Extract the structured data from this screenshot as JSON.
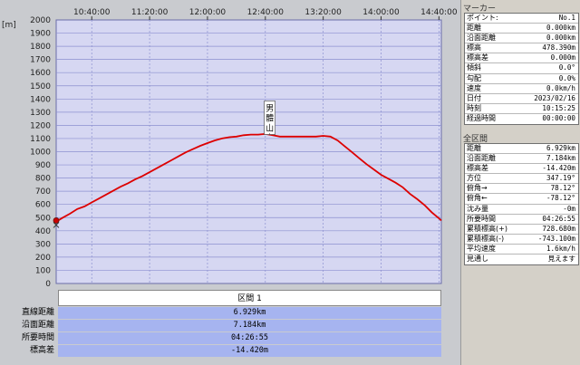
{
  "chart_data": {
    "type": "line",
    "title": "",
    "xlabel": "",
    "ylabel": "[m]",
    "ylim": [
      0,
      2000
    ],
    "yticks": [
      "0",
      "100",
      "200",
      "300",
      "400",
      "500",
      "600",
      "700",
      "800",
      "900",
      "1000",
      "1100",
      "1200",
      "1300",
      "1400",
      "1500",
      "1600",
      "1700",
      "1800",
      "1900",
      "2000"
    ],
    "xlim": [
      "10:15:25",
      "14:41:40"
    ],
    "xticks": [
      "10:40:00",
      "11:20:00",
      "12:00:00",
      "12:40:00",
      "13:20:00",
      "14:00:00",
      "14:40:00"
    ],
    "grid": true,
    "line_color": "#dd0000",
    "series": [
      {
        "x": [
          "10:15:25",
          "10:17:00",
          "10:20:00",
          "10:25:00",
          "10:30:00",
          "10:35:00",
          "10:40:00",
          "10:45:00",
          "10:50:00",
          "10:55:00",
          "11:00:00",
          "11:05:00",
          "11:10:00",
          "11:15:00",
          "11:20:00",
          "11:25:00",
          "11:30:00",
          "11:35:00",
          "11:40:00",
          "11:45:00",
          "11:50:00",
          "11:55:00",
          "12:00:00",
          "12:05:00",
          "12:10:00",
          "12:15:00",
          "12:20:00",
          "12:25:00",
          "12:30:00",
          "12:35:00",
          "12:40:00",
          "12:45:00",
          "12:50:00",
          "12:55:00",
          "13:00:00",
          "13:05:00",
          "13:10:00",
          "13:15:00",
          "13:20:00",
          "13:25:00",
          "13:30:00",
          "13:35:00",
          "13:40:00",
          "13:45:00",
          "13:50:00",
          "13:55:00",
          "14:00:00",
          "14:05:00",
          "14:10:00",
          "14:15:00",
          "14:20:00",
          "14:25:00",
          "14:30:00",
          "14:35:00",
          "14:40:00",
          "14:41:40"
        ],
        "y": [
          478,
          480,
          500,
          530,
          565,
          585,
          615,
          645,
          675,
          705,
          735,
          760,
          790,
          815,
          845,
          875,
          905,
          935,
          965,
          995,
          1020,
          1045,
          1065,
          1085,
          1100,
          1110,
          1115,
          1125,
          1130,
          1130,
          1135,
          1125,
          1115,
          1115,
          1115,
          1115,
          1115,
          1115,
          1120,
          1115,
          1085,
          1040,
          995,
          950,
          905,
          865,
          825,
          795,
          765,
          730,
          680,
          640,
          595,
          540,
          495,
          478
        ]
      }
    ],
    "annotation": "男\n體\n山"
  },
  "summary": {
    "header": "区間 1",
    "rows": [
      {
        "label": "直線距離",
        "value": "6.929km"
      },
      {
        "label": "沿面距離",
        "value": "7.184km"
      },
      {
        "label": "所要時間",
        "value": "04:26:55"
      },
      {
        "label": "標高差",
        "value": "-14.420m"
      }
    ]
  },
  "sidebar": {
    "marker_title": "マーカー",
    "marker_rows": [
      {
        "k": "ポイント:",
        "v": "No.1"
      },
      {
        "k": "距離",
        "v": "0.000km"
      },
      {
        "k": "沿面距離",
        "v": "0.000km"
      },
      {
        "k": "標高",
        "v": "478.390m"
      },
      {
        "k": "標高差",
        "v": "0.000m"
      },
      {
        "k": "傾斜",
        "v": "0.0°"
      },
      {
        "k": "勾配",
        "v": "0.0%"
      },
      {
        "k": "速度",
        "v": "0.0km/h"
      },
      {
        "k": "日付",
        "v": "2023/02/16"
      },
      {
        "k": "時刻",
        "v": "10:15:25"
      },
      {
        "k": "経過時間",
        "v": "00:00:00"
      }
    ],
    "all_title": "全区間",
    "all_rows": [
      {
        "k": "距離",
        "v": "6.929km"
      },
      {
        "k": "沿面距離",
        "v": "7.184km"
      },
      {
        "k": "標高差",
        "v": "-14.420m"
      },
      {
        "k": "方位",
        "v": "347.19°"
      },
      {
        "k": "俯角→",
        "v": "78.12°"
      },
      {
        "k": "俯角←",
        "v": "-78.12°"
      },
      {
        "k": "沈み量",
        "v": "-0m"
      },
      {
        "k": "所要時間",
        "v": "04:26:55"
      },
      {
        "k": "累積標高(+)",
        "v": "728.680m"
      },
      {
        "k": "累積標高(-)",
        "v": "-743.100m"
      },
      {
        "k": "平均速度",
        "v": "1.6km/h"
      },
      {
        "k": "見通し",
        "v": "見えます"
      }
    ]
  },
  "colors": {
    "plot_bg": "#d6d7f2",
    "grid": "#8c90d0",
    "line": "#dd0000",
    "summary_cell": "#a6b4f0"
  }
}
